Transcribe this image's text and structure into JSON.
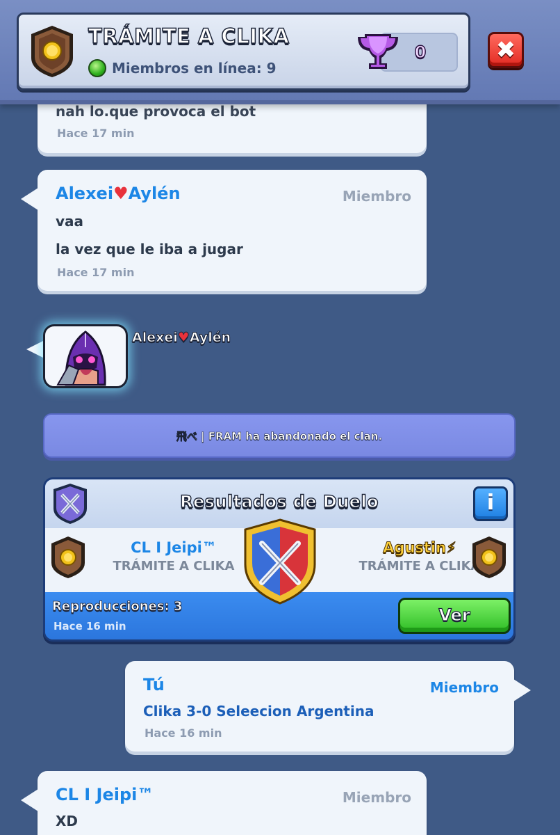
{
  "header": {
    "clan_name": "TRÁMITE A CLIKA",
    "online_label": "Miembros en línea: 9",
    "trophies": "0",
    "close_label": "✖"
  },
  "messages": [
    {
      "text": "nah lo.que provoca el bot",
      "time": "Hace 17  min"
    },
    {
      "sender_part1": "Alexei",
      "heart": "♥",
      "sender_part2": "Aylén",
      "role": "Miembro",
      "lines": [
        "vaa",
        "la vez que le iba a jugar"
      ],
      "time": "Hace 17  min"
    },
    {
      "sender_part1": "Alexei",
      "heart": "♥",
      "sender_part2": "Aylén"
    }
  ],
  "notice": {
    "text": "飛べ | FRAM ha abandonado el clan."
  },
  "duel": {
    "title": "Resultados de Duelo",
    "info_label": "i",
    "left_player": "CL I Jeipi™",
    "left_clan": "TRÁMITE A CLIKA",
    "right_player": "Agustin⚡",
    "right_clan": "TRÁMITE A CLIKA",
    "replays": "Reproducciones: 3",
    "time": "Hace 16  min",
    "button_label": "Ver"
  },
  "own_message": {
    "sender": "Tú",
    "role": "Miembro",
    "text": "Clika 3-0 Seleecion Argentina",
    "time": "Hace 16  min"
  },
  "last_message": {
    "sender": "CL I Jeipi™",
    "role": "Miembro",
    "text": "XD"
  },
  "colors": {
    "background": "#3f5a86",
    "sender_blue": "#1c86e6",
    "close_red": "#e22a22",
    "button_green": "#2fbd26"
  }
}
